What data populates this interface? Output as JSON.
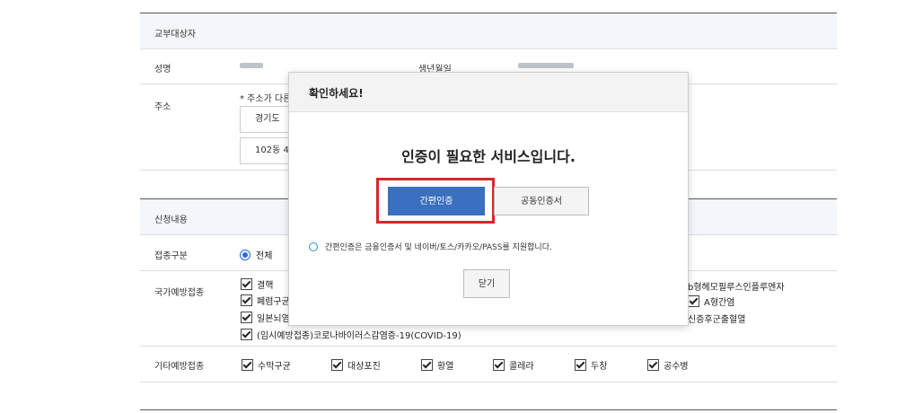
{
  "recipient_section": {
    "title": "교부대상자",
    "name_label": "성명",
    "birth_label": "생년월일",
    "address_label": "주소",
    "address_note": "* 주소가 다른",
    "address_line1": "경기도 ",
    "address_line2": "102동 4"
  },
  "application_section": {
    "title": "신청내용",
    "type_label": "접종구분",
    "type_value": "전체",
    "national_label": "국가예방접종",
    "national_items_left": [
      "결핵",
      "폐렴구균",
      "일본뇌염"
    ],
    "national_items_right": [
      "b형헤모필루스인플루엔자",
      "A형간염",
      "신증후군출혈열"
    ],
    "national_item_covid": "(임시예방접종)코로나바이러스감염증-19(COVID-19)",
    "other_label": "기타예방접종",
    "other_items": [
      "수막구균",
      "대상포진",
      "황열",
      "콜레라",
      "두창",
      "공수병"
    ]
  },
  "modal": {
    "title": "확인하세요!",
    "message": "인증이 필요한 서비스입니다.",
    "easy_auth_button": "간편인증",
    "cert_button": "공동인증서",
    "info_text": "간편인증은 금융인증서 및 네이버/토스/카카오/PASS를 지원합니다.",
    "close_button": "닫기"
  },
  "colors": {
    "primary_button": "#3b6fbf",
    "highlight_frame": "#d8262b",
    "header_row_bg": "#f3f6fa"
  }
}
